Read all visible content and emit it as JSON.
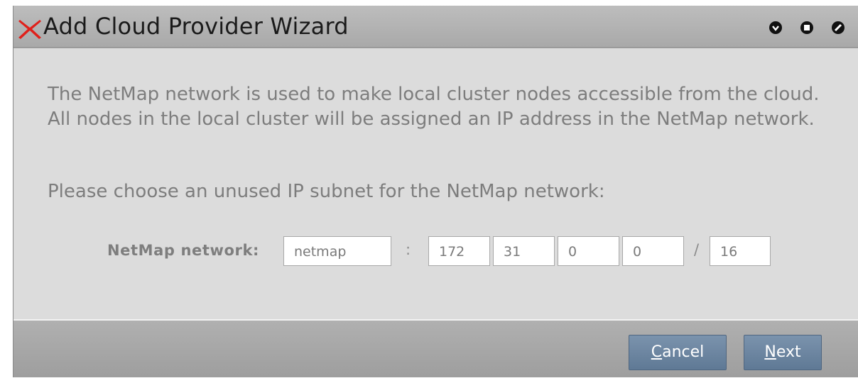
{
  "window": {
    "title": "Add Cloud Provider Wizard",
    "app_icon": "red-x-icon",
    "controls": [
      {
        "name": "minimize-icon"
      },
      {
        "name": "maximize-icon"
      },
      {
        "name": "close-icon"
      }
    ]
  },
  "content": {
    "intro": "The NetMap network is used to make local cluster nodes accessible from the cloud. All nodes in the local cluster will be assigned an IP address in the NetMap network.",
    "prompt": "Please choose an unused IP subnet for the NetMap network:",
    "field_label": "NetMap network:",
    "name_value": "netmap",
    "sep_colon": ":",
    "octets": [
      "172",
      "31",
      "0",
      "0"
    ],
    "sep_slash": "/",
    "prefix": "16"
  },
  "buttons": {
    "cancel": {
      "mnemonic": "C",
      "rest": "ancel"
    },
    "next": {
      "mnemonic": "N",
      "rest": "ext"
    }
  },
  "colors": {
    "accent_button": "#6b84a0",
    "title_x": "#e0201a"
  }
}
